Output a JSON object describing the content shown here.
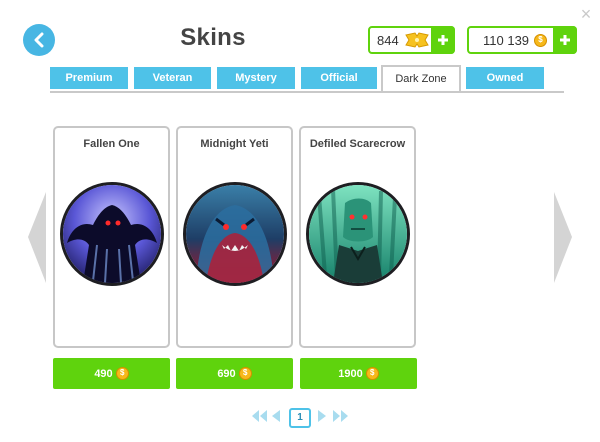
{
  "window": {
    "close_label": "×"
  },
  "header": {
    "title": "Skins"
  },
  "currencies": {
    "tickets": {
      "amount": "844",
      "icon": "ticket-icon"
    },
    "coins": {
      "amount": "110 139",
      "icon": "coin-icon"
    }
  },
  "tabs": [
    {
      "label": "Premium"
    },
    {
      "label": "Veteran"
    },
    {
      "label": "Mystery"
    },
    {
      "label": "Official"
    },
    {
      "label": "Dark Zone",
      "active": true
    },
    {
      "label": "Owned"
    }
  ],
  "skins": [
    {
      "name": "Fallen One",
      "price": "490"
    },
    {
      "name": "Midnight Yeti",
      "price": "690"
    },
    {
      "name": "Defiled Scarecrow",
      "price": "1900"
    }
  ],
  "pager": {
    "current_page": "1"
  },
  "colors": {
    "accent_blue": "#4ec2e8",
    "green": "#5fd30d",
    "coin": "#f6b81a"
  }
}
